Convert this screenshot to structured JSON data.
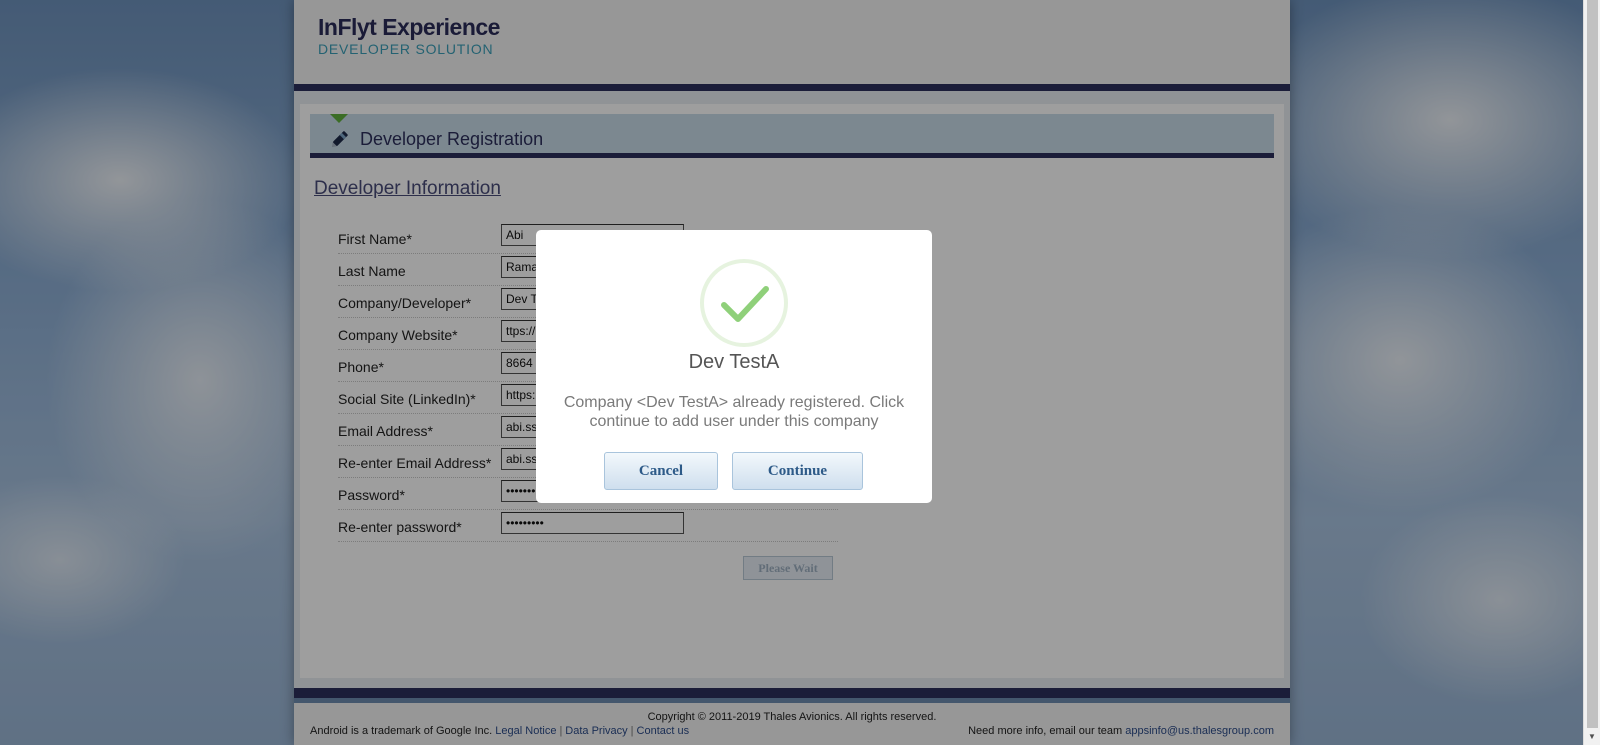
{
  "header": {
    "brand_title": "InFlyt Experience",
    "brand_subtitle": "DEVELOPER SOLUTION"
  },
  "section": {
    "title": "Developer Registration",
    "icon": "pen-icon"
  },
  "form": {
    "heading": "Developer Information",
    "fields": [
      {
        "label": "First Name*",
        "value": "Abi",
        "type": "text"
      },
      {
        "label": "Last Name",
        "value": "Rama",
        "type": "text"
      },
      {
        "label": "Company/Developer*",
        "value": "Dev T",
        "type": "text"
      },
      {
        "label": "Company Website*",
        "value": "ttps://",
        "type": "text"
      },
      {
        "label": "Phone*",
        "value": "8664",
        "type": "text"
      },
      {
        "label": "Social Site (LinkedIn)*",
        "value": "https:",
        "type": "text"
      },
      {
        "label": "Email Address*",
        "value": "abi.ss",
        "type": "text"
      },
      {
        "label": "Re-enter Email Address*",
        "value": "abi.ss",
        "type": "text"
      },
      {
        "label": "Password*",
        "value": "•••••••",
        "type": "password"
      },
      {
        "label": "Re-enter password*",
        "value": "•••••••••",
        "type": "password"
      }
    ],
    "submit_label": "Please Wait"
  },
  "footer": {
    "copyright": "Copyright © 2011-2019 Thales Avionics. All rights reserved.",
    "trademark": "Android is a trademark of Google Inc.",
    "legal_link": "Legal Notice",
    "privacy_link": "Data Privacy",
    "contact_link": "Contact us",
    "info_text": "Need more info, email our team",
    "email_link": "appsinfo@us.thalesgroup.com"
  },
  "modal": {
    "icon": "checkmark-icon",
    "title": "Dev TestA",
    "message": "Company <Dev TestA> already registered. Click continue to add user under this company",
    "cancel_label": "Cancel",
    "continue_label": "Continue"
  },
  "colors": {
    "navy": "#2d2f5c",
    "teal": "#3a9fb8",
    "success_green": "#8fd07a",
    "button_text": "#2d5a88"
  }
}
